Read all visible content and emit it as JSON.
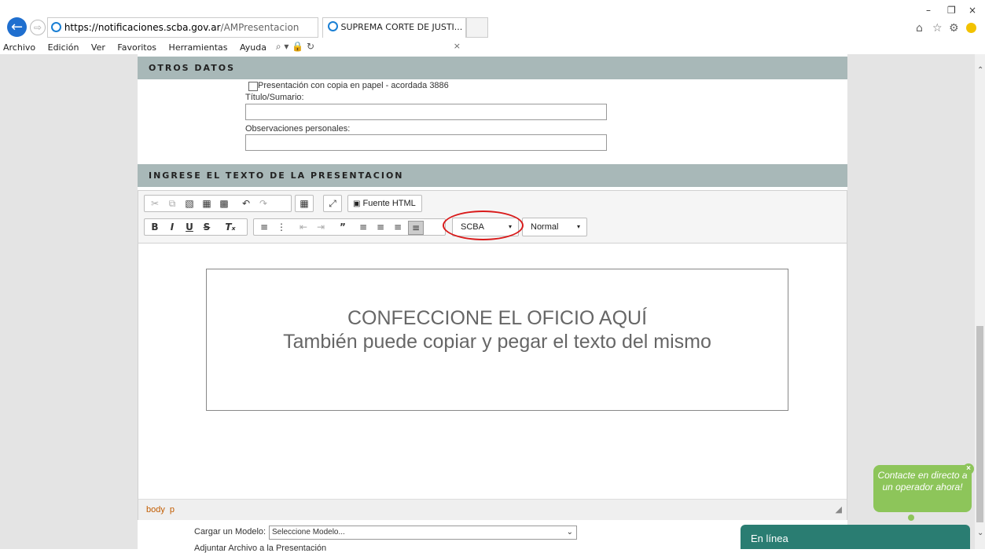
{
  "browser": {
    "url_host": "https://notificaciones.scba.gov.ar",
    "url_path": "/AMPresentacion",
    "url_icons": "⌕ ▾ 🔒 ↻",
    "tab_title": "SUPREMA CORTE DE JUSTI...",
    "menu": [
      "Archivo",
      "Edición",
      "Ver",
      "Favoritos",
      "Herramientas",
      "Ayuda"
    ]
  },
  "otros_datos": {
    "header": "OTROS DATOS",
    "checkbox_label": "Presentación con copia en papel - acordada 3886",
    "titulo_label": "Título/Sumario:",
    "titulo_value": "",
    "observaciones_label": "Observaciones personales:",
    "observaciones_value": ""
  },
  "texto": {
    "header": "INGRESE EL TEXTO DE LA PRESENTACION",
    "source_button": "Fuente HTML",
    "font_select": "SCBA",
    "format_select": "Normal",
    "placeholder_line1": "CONFECCIONE EL OFICIO AQUÍ",
    "placeholder_line2": "También puede copiar y pegar el texto del mismo",
    "path_body": "body",
    "path_p": "p"
  },
  "footer": {
    "modelo_label": "Cargar un Modelo:",
    "modelo_select": "Seleccione Modelo...",
    "adjuntar_label": "Adjuntar Archivo a la Presentación"
  },
  "chat": {
    "bubble_text": "Contacte en directo a un operador ahora!",
    "bar_label": "En línea"
  },
  "colors": {
    "section_header": "#a8b8b8",
    "chat_green": "#8dc55a",
    "chat_bar": "#2a7d72",
    "highlight_circle": "#d91a1a"
  }
}
